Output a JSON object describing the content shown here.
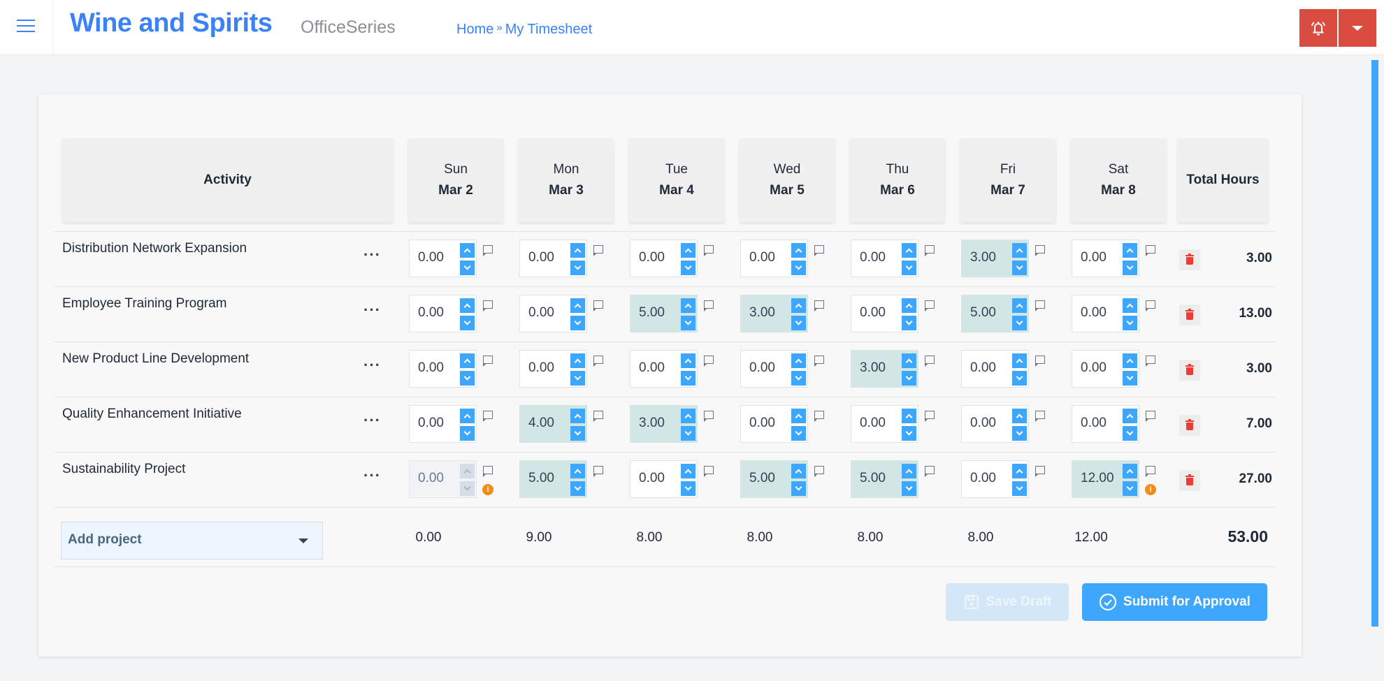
{
  "header": {
    "app_title": "Wine and Spirits",
    "app_subtitle": "OfficeSeries",
    "breadcrumb": [
      {
        "label": "Home"
      },
      {
        "label": "My Timesheet"
      }
    ],
    "breadcrumb_separator": "»",
    "icons": {
      "menu": "hamburger-menu-icon",
      "notifications": "bell-ringing-icon",
      "dropdown": "caret-down-icon"
    }
  },
  "colors": {
    "brand": "#3b82f6",
    "accent": "#3ea6fb",
    "danger": "#d94c3f",
    "filled_cell": "#d3e6e6",
    "warning": "#f28c18"
  },
  "timesheet": {
    "activity_header": "Activity",
    "total_header": "Total Hours",
    "days": [
      {
        "name": "Sun",
        "date": "Mar 2"
      },
      {
        "name": "Mon",
        "date": "Mar 3"
      },
      {
        "name": "Tue",
        "date": "Mar 4"
      },
      {
        "name": "Wed",
        "date": "Mar 5"
      },
      {
        "name": "Thu",
        "date": "Mar 6"
      },
      {
        "name": "Fri",
        "date": "Mar 7"
      },
      {
        "name": "Sat",
        "date": "Mar 8"
      }
    ],
    "row_menu_label": "···",
    "rows": [
      {
        "project": "Distribution Network Expansion",
        "hours": [
          "0.00",
          "0.00",
          "0.00",
          "0.00",
          "0.00",
          "3.00",
          "0.00"
        ],
        "total": "3.00",
        "disabled": [],
        "info": []
      },
      {
        "project": "Employee Training Program",
        "hours": [
          "0.00",
          "0.00",
          "5.00",
          "3.00",
          "0.00",
          "5.00",
          "0.00"
        ],
        "total": "13.00",
        "disabled": [],
        "info": []
      },
      {
        "project": "New Product Line Development",
        "hours": [
          "0.00",
          "0.00",
          "0.00",
          "0.00",
          "3.00",
          "0.00",
          "0.00"
        ],
        "total": "3.00",
        "disabled": [],
        "info": []
      },
      {
        "project": "Quality Enhancement Initiative",
        "hours": [
          "0.00",
          "4.00",
          "3.00",
          "0.00",
          "0.00",
          "0.00",
          "0.00"
        ],
        "total": "7.00",
        "disabled": [],
        "info": []
      },
      {
        "project": "Sustainability Project",
        "hours": [
          "0.00",
          "5.00",
          "0.00",
          "5.00",
          "5.00",
          "0.00",
          "12.00"
        ],
        "total": "27.00",
        "disabled": [
          0
        ],
        "info": [
          0,
          6
        ]
      }
    ],
    "add_project_label": "Add project",
    "day_totals": [
      "0.00",
      "9.00",
      "8.00",
      "8.00",
      "8.00",
      "8.00",
      "12.00"
    ],
    "grand_total": "53.00",
    "info_glyph": "i"
  },
  "actions": {
    "save_draft": "Save Draft",
    "save_draft_disabled": true,
    "submit": "Submit for Approval"
  }
}
